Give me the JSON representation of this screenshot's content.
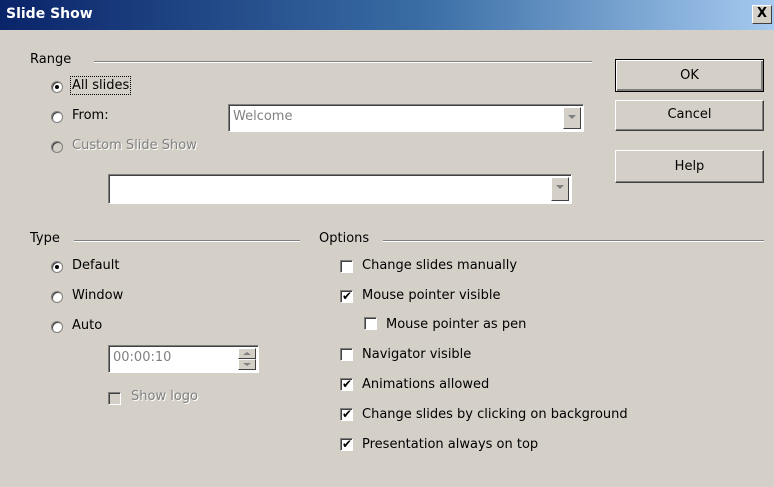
{
  "window": {
    "title": "Slide Show",
    "close_label": "X"
  },
  "range": {
    "group_label": "Range",
    "all_slides": {
      "label": "All slides",
      "checked": true
    },
    "from": {
      "label": "From:",
      "checked": false,
      "combo_value": "Welcome"
    },
    "custom": {
      "label": "Custom Slide Show",
      "checked": false,
      "enabled": false,
      "combo_value": ""
    }
  },
  "buttons": {
    "ok": "OK",
    "cancel": "Cancel",
    "help": "Help"
  },
  "type": {
    "group_label": "Type",
    "default": {
      "label": "Default",
      "checked": true
    },
    "window": {
      "label": "Window",
      "checked": false
    },
    "auto": {
      "label": "Auto",
      "checked": false
    },
    "pause_value": "00:00:10",
    "show_logo": {
      "label": "Show logo",
      "checked": false,
      "enabled": false
    }
  },
  "options": {
    "group_label": "Options",
    "change_manually": {
      "label": "Change slides manually",
      "checked": false
    },
    "mouse_visible": {
      "label": "Mouse pointer visible",
      "checked": true
    },
    "mouse_pen": {
      "label": "Mouse pointer as pen",
      "checked": false
    },
    "navigator": {
      "label": "Navigator visible",
      "checked": false
    },
    "animations": {
      "label": "Animations allowed",
      "checked": true
    },
    "click_background": {
      "label": "Change slides by clicking on background",
      "checked": true
    },
    "always_on_top": {
      "label": "Presentation always on top",
      "checked": true
    }
  }
}
